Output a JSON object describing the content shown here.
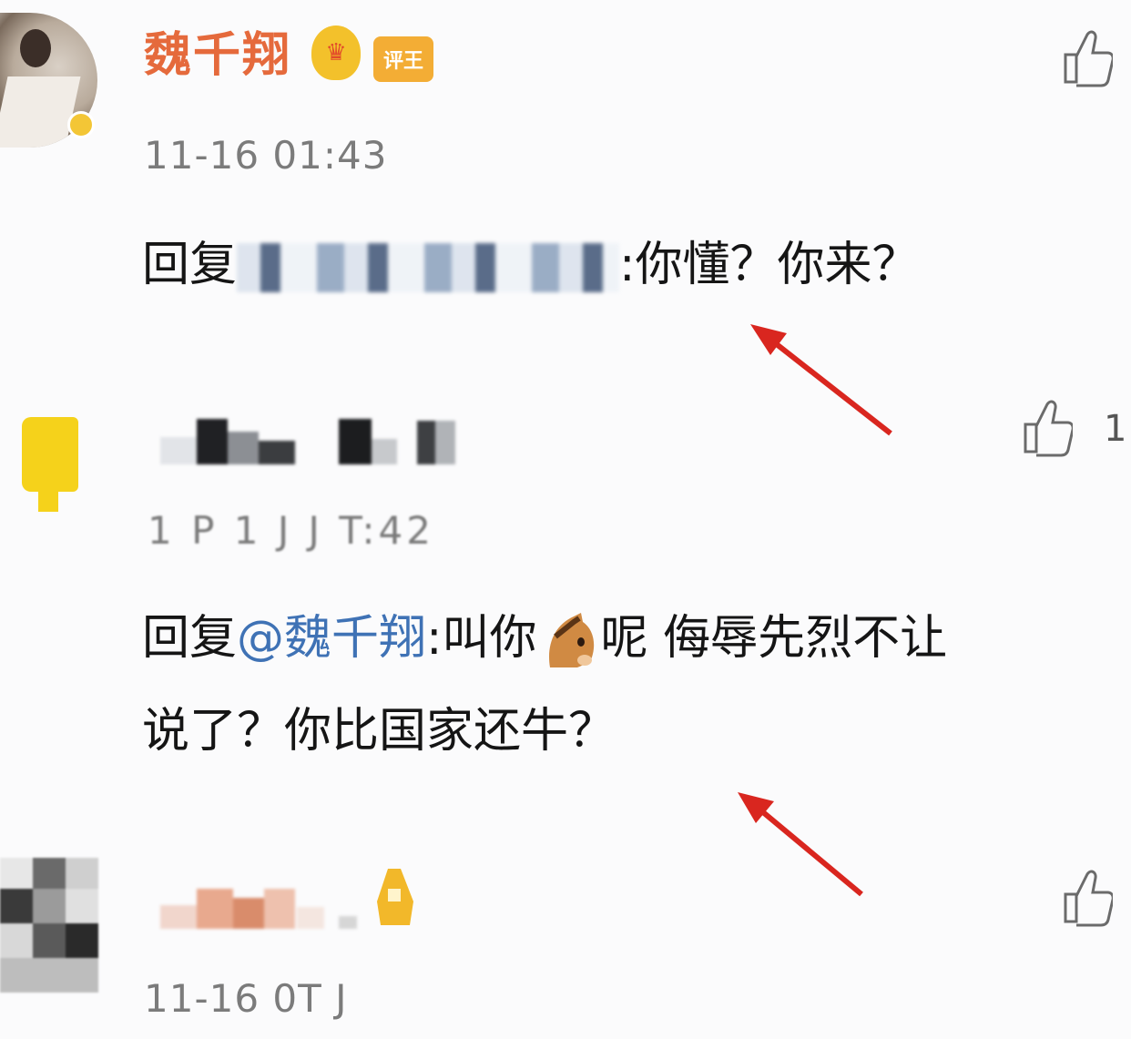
{
  "comments": [
    {
      "username": "魏千翔",
      "crown_icon": "crown-icon",
      "rank_badge": "评王",
      "timestamp": "11-16 01:43",
      "reply_prefix": "回复",
      "reply_text": ":你懂？你来？"
    },
    {
      "timestamp": "1 P 1 J  J T:42",
      "like_count": "1",
      "reply_prefix": "回复",
      "mention": "@魏千翔",
      "reply_text_1": ":叫你",
      "emoji": "horse-emoji",
      "reply_text_2": "呢 侮辱先烈不让",
      "reply_text_3": "说了？你比国家还牛？"
    },
    {
      "timestamp": "11-16 0T J"
    }
  ],
  "colors": {
    "username": "#e56a3c",
    "mention": "#3f72b5",
    "arrow": "#d9261f",
    "timestamp": "#7b7b7b"
  }
}
